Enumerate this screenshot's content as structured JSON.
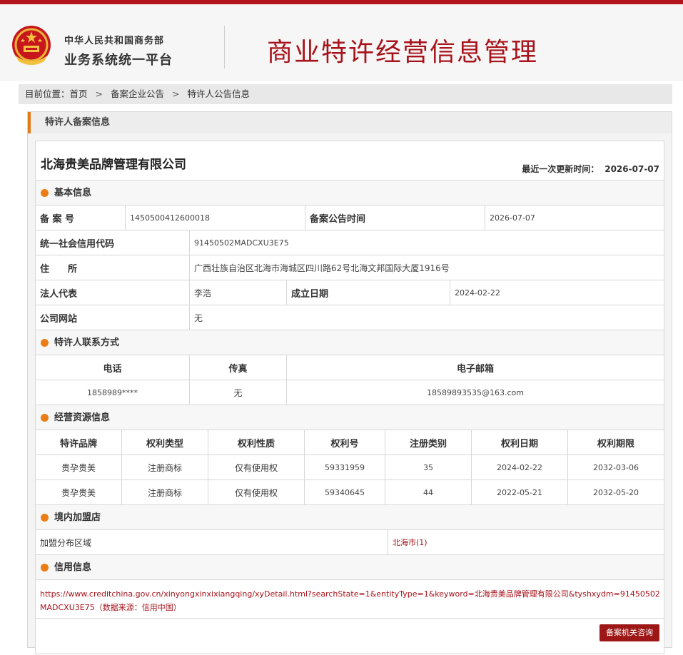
{
  "header": {
    "ministry": "中华人民共和国商务部",
    "platform": "业务系统统一平台",
    "title": "商业特许经营信息管理"
  },
  "breadcrumb": {
    "prefix": "目前位置：",
    "items": [
      "首页",
      "备案企业公告",
      "特许人公告信息"
    ]
  },
  "panel_title": "特许人备案信息",
  "company": {
    "name": "北海贵美品牌管理有限公司",
    "updated_label": "最近一次更新时间：",
    "updated_value": "2026-07-07"
  },
  "basic": {
    "section_title": "基本信息",
    "record_no_label": "备 案 号",
    "record_no": "1450500412600018",
    "announce_time_label": "备案公告时间",
    "announce_time": "2026-07-07",
    "credit_code_label": "统一社会信用代码",
    "credit_code": "91450502MADCXU3E75",
    "address_label": "住　　所",
    "address": "广西壮族自治区北海市海城区四川路62号北海文邦国际大厦1916号",
    "legal_rep_label": "法人代表",
    "legal_rep": "李浩",
    "founded_label": "成立日期",
    "founded": "2024-02-22",
    "website_label": "公司网站",
    "website": "无"
  },
  "contact": {
    "section_title": "特许人联系方式",
    "headers": [
      "电话",
      "传真",
      "电子邮箱"
    ],
    "values": [
      "1858989****",
      "无",
      "18589893535@163.com"
    ]
  },
  "resources": {
    "section_title": "经营资源信息",
    "headers": [
      "特许品牌",
      "权利类型",
      "权利性质",
      "权利号",
      "注册类别",
      "权利日期",
      "权利期限"
    ],
    "rows": [
      [
        "贵孕贵美",
        "注册商标",
        "仅有使用权",
        "59331959",
        "35",
        "2024-02-22",
        "2032-03-06"
      ],
      [
        "贵孕贵美",
        "注册商标",
        "仅有使用权",
        "59340645",
        "44",
        "2022-05-21",
        "2032-05-20"
      ]
    ]
  },
  "stores": {
    "section_title": "境内加盟店",
    "label": "加盟分布区域",
    "value": "北海市(1)"
  },
  "credit": {
    "section_title": "信用信息",
    "url": "https://www.creditchina.gov.cn/xinyongxinxixiangqing/xyDetail.html?searchState=1&entityType=1&keyword=北海贵美品牌管理有限公司&tyshxydm=91450502MADCXU3E75（数据来源：信用中国）",
    "button": "备案机关咨询"
  },
  "colors": {
    "brand_red": "#a8121a",
    "accent_orange": "#ec7d14",
    "button_red": "#9d1717"
  }
}
